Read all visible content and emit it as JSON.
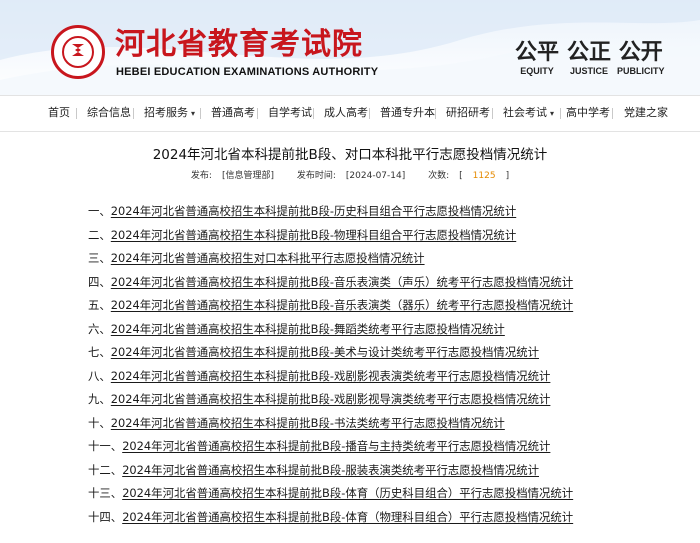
{
  "header": {
    "title": "河北省教育考试院",
    "subtitle": "HEBEI EDUCATION EXAMINATIONS AUTHORITY",
    "mottos": [
      {
        "big": "公平",
        "en": "EQUITY"
      },
      {
        "big": "公正",
        "en": "JUSTICE"
      },
      {
        "big": "公开",
        "en": "PUBLICITY"
      }
    ]
  },
  "nav": {
    "items": [
      {
        "label": "首页"
      },
      {
        "label": "综合信息"
      },
      {
        "label": "招考服务",
        "caret": "▾"
      },
      {
        "label": "普通高考"
      },
      {
        "label": "自学考试"
      },
      {
        "label": "成人高考"
      },
      {
        "label": "普通专升本"
      },
      {
        "label": "研招研考"
      },
      {
        "label": "社会考试",
        "caret": "▾"
      },
      {
        "label": "高中学考"
      },
      {
        "label": "党建之家"
      }
    ]
  },
  "article": {
    "title": "2024年河北省本科提前批B段、对口本科批平行志愿投档情况统计",
    "publisher_label": "发布:",
    "publisher": "[信息管理部]",
    "date_label": "发布时间:",
    "date": "[2024-07-14]",
    "views_label": "次数:",
    "views_open": "[",
    "views": "1125",
    "views_close": "]"
  },
  "links": [
    {
      "idx": "一、",
      "text": "2024年河北省普通高校招生本科提前批B段-历史科目组合平行志愿投档情况统计"
    },
    {
      "idx": "二、",
      "text": "2024年河北省普通高校招生本科提前批B段-物理科目组合平行志愿投档情况统计"
    },
    {
      "idx": "三、",
      "text": "2024年河北省普通高校招生对口本科批平行志愿投档情况统计"
    },
    {
      "idx": "四、",
      "text": "2024年河北省普通高校招生本科提前批B段-音乐表演类（声乐）统考平行志愿投档情况统计"
    },
    {
      "idx": "五、",
      "text": "2024年河北省普通高校招生本科提前批B段-音乐表演类（器乐）统考平行志愿投档情况统计"
    },
    {
      "idx": "六、",
      "text": "2024年河北省普通高校招生本科提前批B段-舞蹈类统考平行志愿投档情况统计"
    },
    {
      "idx": "七、",
      "text": "2024年河北省普通高校招生本科提前批B段-美术与设计类统考平行志愿投档情况统计"
    },
    {
      "idx": "八、",
      "text": "2024年河北省普通高校招生本科提前批B段-戏剧影视表演类统考平行志愿投档情况统计"
    },
    {
      "idx": "九、",
      "text": "2024年河北省普通高校招生本科提前批B段-戏剧影视导演类统考平行志愿投档情况统计"
    },
    {
      "idx": "十、",
      "text": "2024年河北省普通高校招生本科提前批B段-书法类统考平行志愿投档情况统计"
    },
    {
      "idx": "十一、",
      "text": "2024年河北省普通高校招生本科提前批B段-播音与主持类统考平行志愿投档情况统计"
    },
    {
      "idx": "十二、",
      "text": "2024年河北省普通高校招生本科提前批B段-服装表演类统考平行志愿投档情况统计"
    },
    {
      "idx": "十三、",
      "text": "2024年河北省普通高校招生本科提前批B段-体育（历史科目组合）平行志愿投档情况统计"
    },
    {
      "idx": "十四、",
      "text": "2024年河北省普通高校招生本科提前批B段-体育（物理科目组合）平行志愿投档情况统计"
    }
  ]
}
